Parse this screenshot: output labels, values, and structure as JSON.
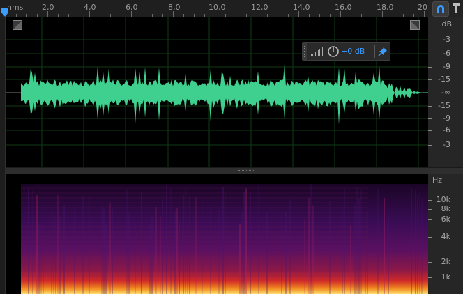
{
  "ruler": {
    "unit_label": "hms",
    "labels": [
      "2,0",
      "4,0",
      "6,0",
      "8,0",
      "10,0",
      "12,0",
      "14,0",
      "16,0",
      "18,0",
      "20"
    ]
  },
  "db_scale": {
    "unit": "dB",
    "labels": [
      "-3",
      "-6",
      "-9",
      "-15",
      "-∞",
      "-15",
      "-9",
      "-6",
      "-3"
    ]
  },
  "hz_scale": {
    "unit": "Hz",
    "labels": [
      "10k",
      "8k",
      "6k",
      "4k",
      "2k",
      "1k"
    ]
  },
  "hud": {
    "gain_value": "+0 dB"
  },
  "colors": {
    "waveform": "#3fcf8e",
    "time_selection_accent": "#3b9cff"
  },
  "icons": {
    "snap": "magnet-icon",
    "pin_ruler": "pin-icon",
    "hud_pin": "pin-icon",
    "volume": "volume-bars-icon",
    "knob": "gain-knob-icon"
  }
}
